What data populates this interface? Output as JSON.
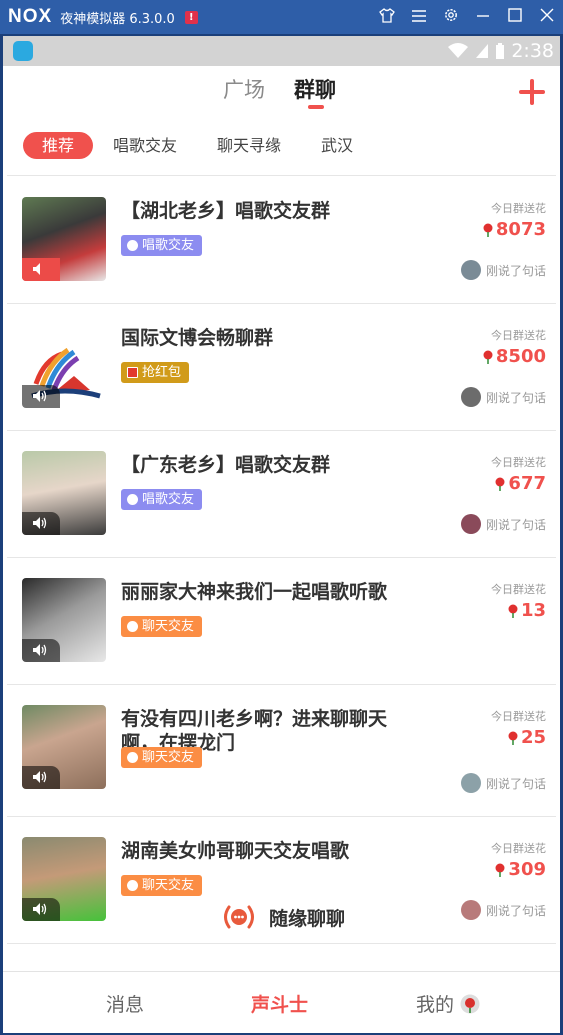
{
  "emulator": {
    "logo": "NOX",
    "title": "夜神模拟器 6.3.0.0",
    "badge": "!",
    "controls": [
      "shirt-icon",
      "menu-icon",
      "gear-icon",
      "minimize-icon",
      "maximize-icon",
      "close-icon"
    ]
  },
  "status_bar": {
    "time": "2:38"
  },
  "nav": {
    "tab_plaza": "广场",
    "tab_group": "群聊",
    "add": "+"
  },
  "filters": [
    "推荐",
    "唱歌交友",
    "聊天寻缘",
    "武汉"
  ],
  "groups": [
    {
      "title": "【湖北老乡】唱歌交友群",
      "tag": "唱歌交友",
      "tag_type": "sing",
      "flowers_label": "今日群送花",
      "flowers": "8073",
      "last": "刚说了句话",
      "thumb": "#a02b2b",
      "said_color": "#7a8b96"
    },
    {
      "title": "国际文博会畅聊群",
      "tag": "抢红包",
      "tag_type": "hb",
      "flowers_label": "今日群送花",
      "flowers": "8500",
      "last": "刚说了句话",
      "thumb": "#ffffff",
      "said_color": "#6c6c6c"
    },
    {
      "title": "【广东老乡】唱歌交友群",
      "tag": "唱歌交友",
      "tag_type": "sing",
      "flowers_label": "今日群送花",
      "flowers": "677",
      "last": "刚说了句话",
      "thumb": "#9ab08a",
      "said_color": "#8a4a5a"
    },
    {
      "title": "丽丽家大神来我们一起唱歌听歌",
      "tag": "聊天交友",
      "tag_type": "chat",
      "flowers_label": "今日群送花",
      "flowers": "13",
      "last": "",
      "thumb": "#777777",
      "said_color": "#777777"
    },
    {
      "title": "有没有四川老乡啊？进来聊聊天啊，在摆龙门",
      "tag": "聊天交友",
      "tag_type": "chat",
      "flowers_label": "今日群送花",
      "flowers": "25",
      "last": "刚说了句话",
      "thumb": "#8d6f5b",
      "said_color": "#8ca1a8"
    },
    {
      "title": "湖南美女帅哥聊天交友唱歌",
      "tag": "聊天交友",
      "tag_type": "chat",
      "flowers_label": "今日群送花",
      "flowers": "309",
      "last": "刚说了句话",
      "thumb": "#6b6b52",
      "said_color": "#b87a7a"
    }
  ],
  "random_chat": "随缘聊聊",
  "bottom_nav": {
    "messages": "消息",
    "fighter": "声斗士",
    "mine": "我的"
  },
  "colors": {
    "accent": "#f0514d",
    "emulator_bar": "#2e5ea8"
  }
}
